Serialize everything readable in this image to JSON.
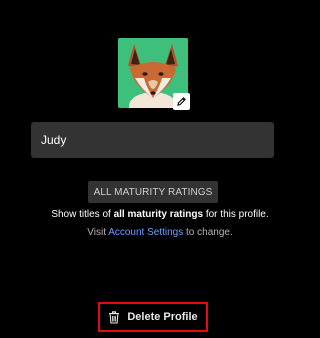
{
  "profile": {
    "avatar_icon": "fox-avatar",
    "edit_icon": "pencil-icon",
    "name_value": "Judy"
  },
  "maturity": {
    "button_label": "ALL MATURITY RATINGS",
    "desc_prefix": "Show titles of ",
    "desc_bold": "all maturity ratings",
    "desc_suffix": " for this profile.",
    "visit_prefix": "Visit ",
    "visit_link": "Account Settings",
    "visit_suffix": " to change."
  },
  "actions": {
    "delete_icon": "trash-icon",
    "delete_label": "Delete Profile"
  },
  "colors": {
    "background": "#000000",
    "field": "#333333",
    "link": "#6aa0ff",
    "highlight": "#e50914",
    "avatar_bg": "#3fbf7c"
  }
}
